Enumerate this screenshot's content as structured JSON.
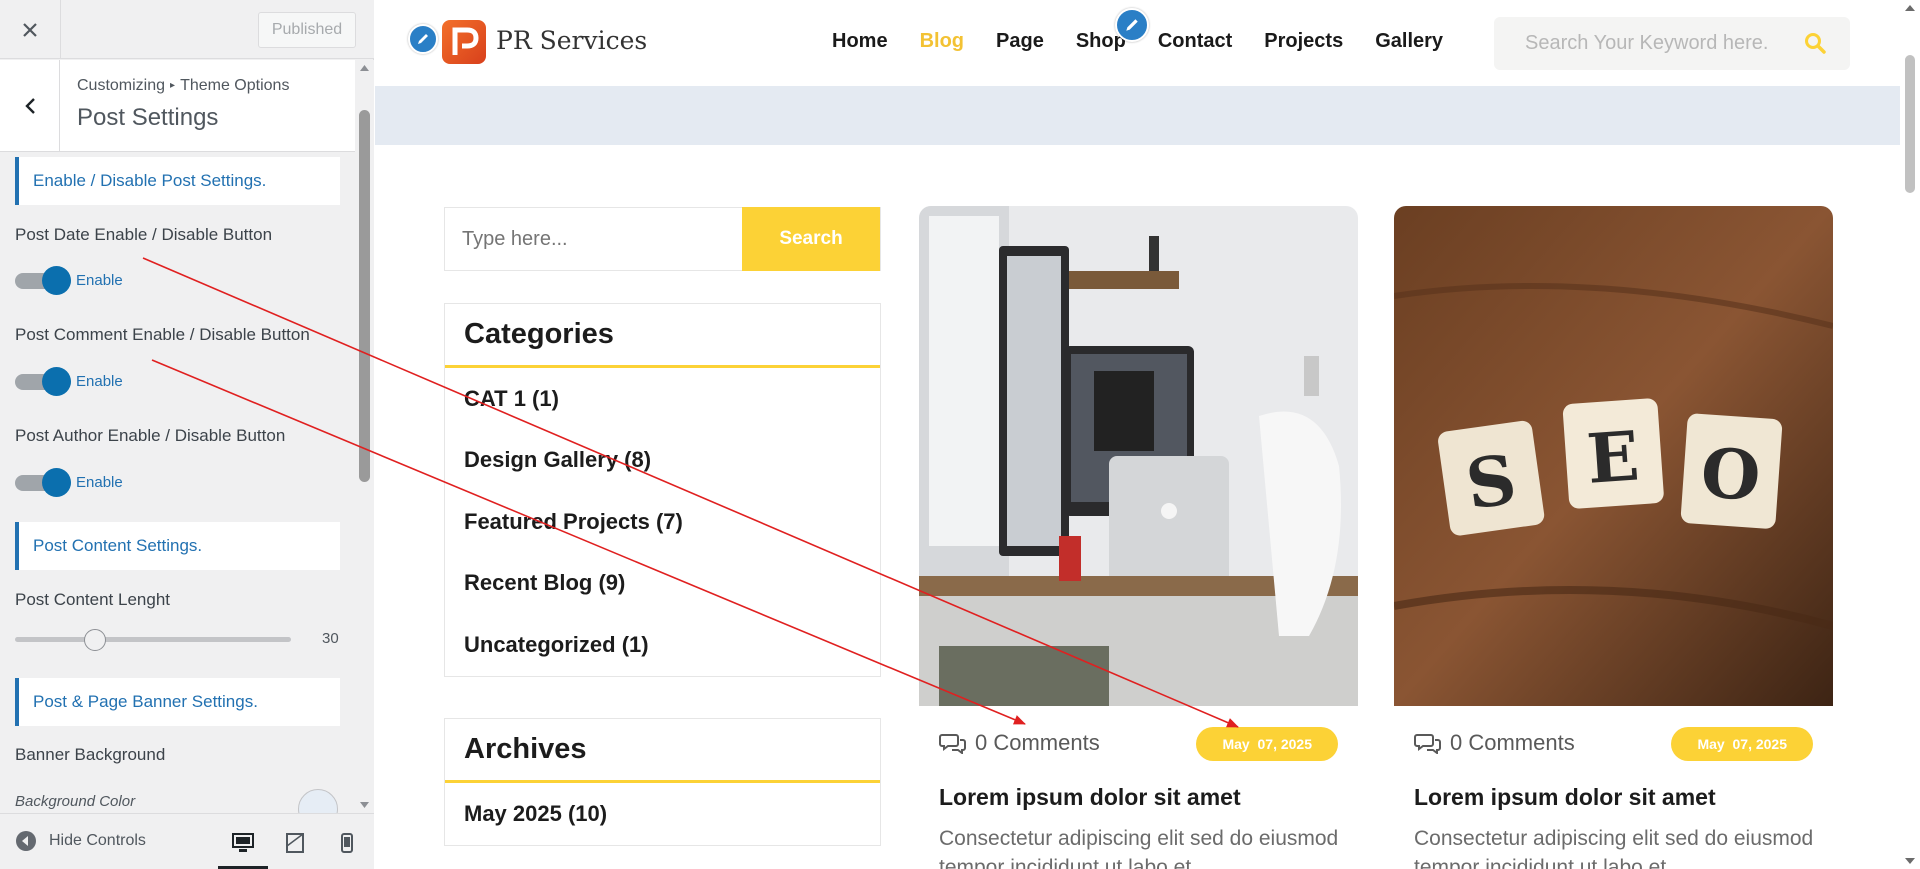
{
  "panel": {
    "published_label": "Published",
    "breadcrumb": {
      "parent": "Customizing",
      "child": "Theme Options"
    },
    "title": "Post Settings",
    "sections": {
      "enable": "Enable / Disable Post Settings.",
      "content": "Post Content Settings.",
      "banner": "Post & Page Banner Settings."
    },
    "options": {
      "date": {
        "label": "Post Date Enable / Disable Button",
        "state": "Enable"
      },
      "comment": {
        "label": "Post Comment Enable / Disable Button",
        "state": "Enable"
      },
      "author": {
        "label": "Post Author Enable / Disable Button",
        "state": "Enable"
      }
    },
    "content_length": {
      "label": "Post Content Lenght",
      "value": "30",
      "fraction": 0.27
    },
    "banner_background": {
      "label": "Banner Background",
      "color_label": "Background Color",
      "color": "#e6edf5"
    },
    "footer": {
      "hide_controls": "Hide Controls"
    }
  },
  "site": {
    "logo_text": "PR Services",
    "nav": [
      "Home",
      "Blog",
      "Page",
      "Shop",
      "Contact",
      "Projects",
      "Gallery"
    ],
    "nav_active": "Blog",
    "search_placeholder": "Search Your Keyword here.",
    "accent": "#fcd236"
  },
  "sidebar": {
    "search_placeholder": "Type here...",
    "search_button": "Search",
    "categories_title": "Categories",
    "categories": [
      "CAT 1 (1)",
      "Design Gallery (8)",
      "Featured Projects (7)",
      "Recent Blog (9)",
      "Uncategorized (1)"
    ],
    "archives_title": "Archives",
    "archives": [
      "May 2025 (10)"
    ]
  },
  "posts": [
    {
      "comments": "0 Comments",
      "date": "May  07, 2025",
      "title": "Lorem ipsum dolor sit amet",
      "excerpt": "Consectetur adipiscing elit sed do eiusmod tempor incididunt ut labo et"
    },
    {
      "comments": "0 Comments",
      "date": "May  07, 2025",
      "title": "Lorem ipsum dolor sit amet",
      "excerpt": "Consectetur adipiscing elit sed do eiusmod tempor incididunt ut labo et"
    }
  ],
  "icons": {
    "close": "close-icon",
    "back": "chevron-left-icon",
    "edit": "pencil-icon",
    "search": "search-icon",
    "comment": "comment-icon",
    "hide": "arrow-left-circle-icon",
    "desktop": "desktop-icon",
    "tablet": "tablet-icon",
    "mobile": "mobile-icon"
  }
}
